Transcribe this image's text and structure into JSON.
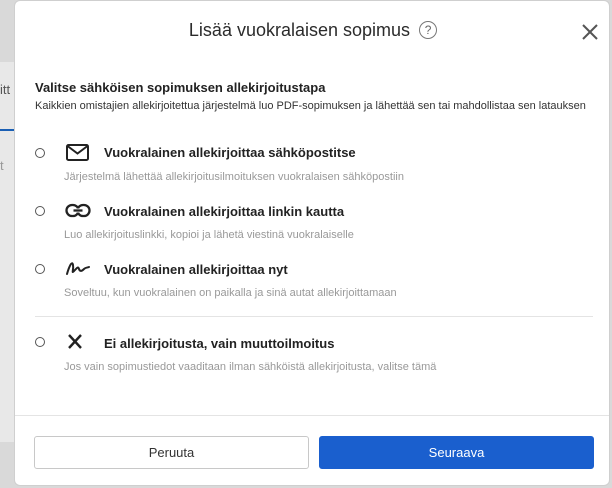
{
  "background": {
    "tab1_label": "itt",
    "tab2_label": "t"
  },
  "modal": {
    "title": "Lisää vuokralaisen sopimus",
    "help_glyph": "?",
    "section_title": "Valitse sähköisen sopimuksen allekirjoitustapa",
    "section_desc": "Kaikkien omistajien allekirjoitettua järjestelmä luo PDF-sopimuksen ja lähettää sen tai mahdollistaa sen latauksen",
    "options": [
      {
        "icon": "envelope-icon",
        "label": "Vuokralainen allekirjoittaa sähköpostitse",
        "desc": "Järjestelmä lähettää allekirjoitusilmoituksen vuokralaisen sähköpostiin"
      },
      {
        "icon": "link-icon",
        "label": "Vuokralainen allekirjoittaa linkin kautta",
        "desc": "Luo allekirjoituslinkki, kopioi ja lähetä viestinä vuokralaiselle"
      },
      {
        "icon": "signature-icon",
        "label": "Vuokralainen allekirjoittaa nyt",
        "desc": "Soveltuu, kun vuokralainen on paikalla ja sinä autat allekirjoittamaan"
      },
      {
        "icon": "x-mark-icon",
        "label": "Ei allekirjoitusta, vain muuttoilmoitus",
        "desc": "Jos vain sopimustiedot vaaditaan ilman sähköistä allekirjoitusta, valitse tämä"
      }
    ],
    "cancel_label": "Peruuta",
    "next_label": "Seuraava"
  },
  "colors": {
    "primary": "#1a5fce",
    "muted_text": "#999999",
    "text": "#222222"
  }
}
